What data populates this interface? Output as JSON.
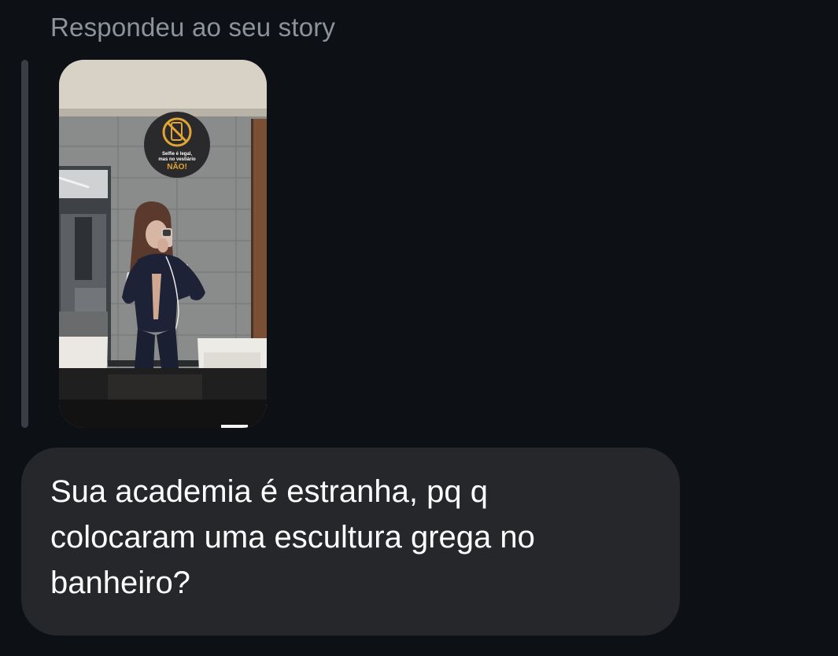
{
  "reply_header": "Respondeu ao seu story",
  "story_sign": {
    "line1": "Selfie é legal,",
    "line2": "mas no vestiário",
    "line3": "NÃO!"
  },
  "message": {
    "text": "Sua academia é estranha, pq q\ncolocaram uma escultura grega no\nbanheiro?"
  },
  "colors": {
    "background": "#0d1015",
    "bubble": "#25272b",
    "header_text": "#8e9299",
    "message_text": "#ffffff",
    "sign_accent": "#e0a534"
  }
}
